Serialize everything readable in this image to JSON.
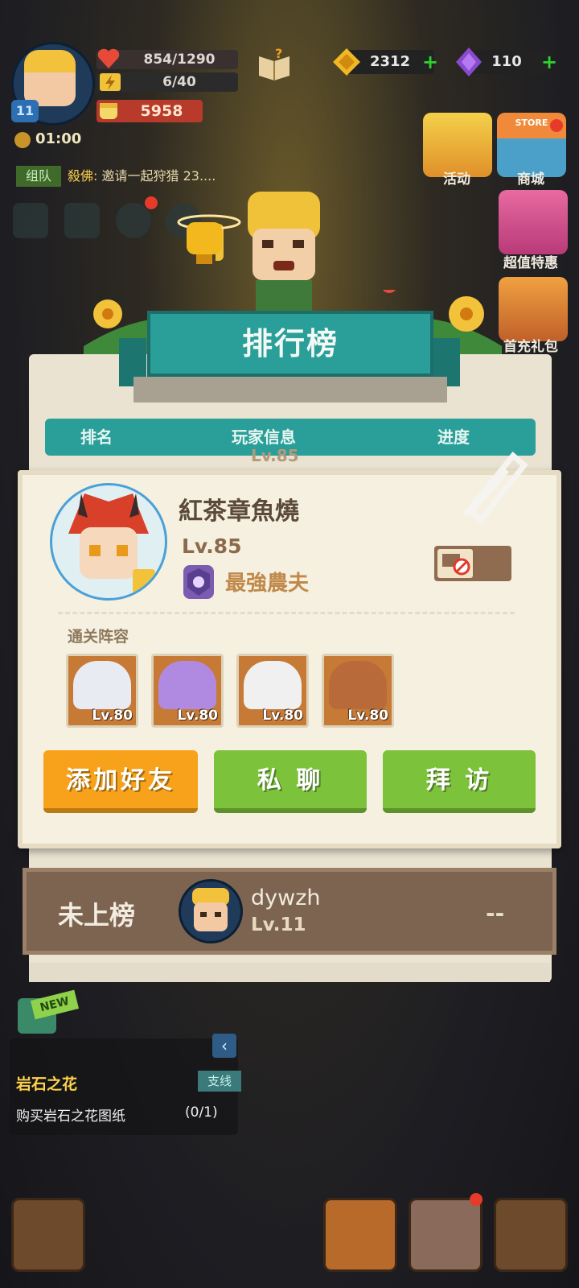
{
  "hud": {
    "player_level": "11",
    "hp": "854/1290",
    "stamina": "6/40",
    "power": "5958",
    "timer": "01:00",
    "gold": "2312",
    "gems": "110"
  },
  "chat": {
    "channel": "组队",
    "sender": "殺佛:",
    "message": "邀请一起狩猎 23...."
  },
  "side_menu": {
    "activity": "活动",
    "shop": "商城",
    "shop_store": "STORE",
    "value_deals": "超值特惠",
    "first_recharge": "首充礼包"
  },
  "leaderboard": {
    "title": "排行榜",
    "columns": [
      "排名",
      "玩家信息",
      "进度"
    ],
    "peek_level": "Lv.85"
  },
  "player_card": {
    "name": "紅茶章魚燒",
    "level": "Lv.85",
    "title": "最強農夫",
    "lineup_label": "通关阵容",
    "lineup": [
      {
        "level": "Lv.80",
        "color": "#e8ecf2"
      },
      {
        "level": "Lv.80",
        "color": "#b08ae0"
      },
      {
        "level": "Lv.80",
        "color": "#f0f0f0"
      },
      {
        "level": "Lv.80",
        "color": "#b86a3a"
      }
    ],
    "buttons": {
      "add_friend": "添加好友",
      "private_chat": "私 聊",
      "visit": "拜 访"
    }
  },
  "self_entry": {
    "rank": "未上榜",
    "name": "dywzh",
    "level": "Lv.11",
    "progress": "--"
  },
  "quest": {
    "new_badge": "NEW",
    "name": "岩石之花",
    "tag": "支线",
    "desc": "购买岩石之花图纸",
    "count": "(0/1)",
    "collapse": "‹"
  },
  "colors": {
    "teal": "#2a9e98",
    "orange": "#f7a21a",
    "green": "#7cc23a",
    "card_bg": "#f6f0e0"
  },
  "icons": {
    "hp": "heart-icon",
    "stamina": "lightning-icon",
    "power": "fist-icon",
    "gold": "gold-coin-icon",
    "gem": "gem-icon",
    "quest_book": "quest-book-icon",
    "report": "report-icon"
  }
}
